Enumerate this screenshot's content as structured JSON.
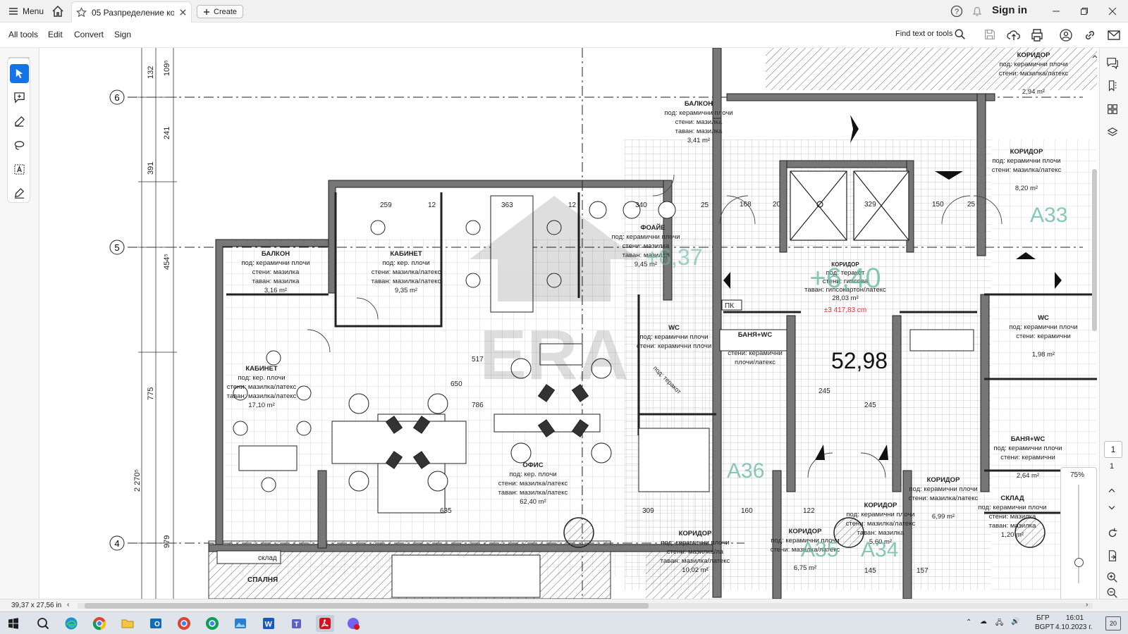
{
  "titlebar": {
    "menu_label": "Menu",
    "tab_title": "05 Разпределение кот...",
    "create_label": "Create",
    "signin_label": "Sign in"
  },
  "toolbar": {
    "items": [
      "All tools",
      "Edit",
      "Convert",
      "Sign"
    ],
    "find_label": "Find text or tools"
  },
  "left_tools": [
    "select-tool",
    "add-comment-tool",
    "highlight-tool",
    "draw-lasso-tool",
    "text-select-tool",
    "fill-sign-tool"
  ],
  "plan": {
    "grid_bubbles": [
      "6",
      "5",
      "4"
    ],
    "rooms": [
      {
        "title": "БАЛКОН",
        "lines": [
          "под: керамични плочи",
          "стени: мазилка",
          "таван: мазилка",
          "3,41 m²"
        ]
      },
      {
        "title": "БАЛКОН",
        "lines": [
          "под: керамични плочи",
          "стени: мазилка",
          "таван: мазилка",
          "3,16 m²"
        ]
      },
      {
        "title": "КАБИНЕТ",
        "lines": [
          "под: кер. плочи",
          "стени: мазилка/латекс",
          "таван: мазилка/латекс",
          "9,35 m²"
        ]
      },
      {
        "title": "ФОАЙЕ",
        "lines": [
          "под: керамични плочи",
          "стени: мазилка",
          "таван: мазилка",
          "9,45 m²"
        ]
      },
      {
        "title": "КАБИНЕТ",
        "lines": [
          "под: кер. плочи",
          "стени: мазилка/латекс",
          "таван: мазилка/латекс",
          "17,10 m²"
        ]
      },
      {
        "title": "ОФИС",
        "lines": [
          "под: кер. плочи",
          "стени: мазилка/латекс",
          "таван: мазилка/латекс",
          "62,40 m²"
        ]
      },
      {
        "title": "WC",
        "lines": [
          "под: керамични плочи",
          "стени: керамични плочи"
        ]
      },
      {
        "title": "БАНЯ+WC",
        "lines": [
          "стени: керамични",
          "плочи/латекс"
        ]
      },
      {
        "title": "КОРИДОР",
        "lines": [
          "под: теракот",
          "стени: гипсова",
          "таван: гипсокартон/латекс",
          "28,03 m²"
        ]
      },
      {
        "title": "КОРИДОР",
        "lines": [
          "под: керамични плочи",
          "стени: мазилка/латекс",
          "2,94 m²"
        ]
      },
      {
        "title": "КОРИДОР",
        "lines": [
          "под: керамични плочи",
          "стени: мазилка/латекс",
          "8,20 m²"
        ]
      },
      {
        "title": "WC",
        "lines": [
          "под: керамични плочи",
          "стени: керамични",
          "1,98 m²"
        ]
      },
      {
        "title": "БАНЯ+WC",
        "lines": [
          "под: керамични плочи",
          "стени: керамични",
          "2,64 m²"
        ]
      },
      {
        "title": "СКЛАД",
        "lines": [
          "под: керамични плочи",
          "стени: мазилка",
          "таван: мазилка",
          "1,20 m²"
        ]
      },
      {
        "title": "КОРИДОР",
        "lines": [
          "под: керамични плочи",
          "стени: мазилка/латекс",
          "6,99 m²"
        ]
      },
      {
        "title": "КОРИДОР",
        "lines": [
          "под: керамични плочи",
          "стени: мазилка/латекс",
          "таван: мазилка",
          "5,60 m²"
        ]
      },
      {
        "title": "КОРИДОР",
        "lines": [
          "под: керамични плочи",
          "стени: мазилка/латекс",
          "6,75 m²"
        ]
      },
      {
        "title": "КОРИДОР",
        "lines": [
          "под: керамични плочи",
          "стени: мазилка/ла",
          "таван: мазилка/латекс",
          "10,02 m²"
        ]
      }
    ],
    "big_area": "52,98",
    "level_mark": "+6,40",
    "level_mark2": "+6,37",
    "level_red": "±3 417,83 cm",
    "unit_labels": [
      "A33",
      "A34",
      "A35",
      "A36"
    ],
    "dims_v": [
      "132",
      "109⁵",
      "241",
      "391",
      "454⁵",
      "775",
      "2 270⁵",
      "979"
    ],
    "dims_h": [
      "259",
      "12",
      "363",
      "12",
      "340",
      "25",
      "650",
      "786",
      "517",
      "635",
      "309",
      "160",
      "245",
      "245",
      "122",
      "145",
      "157",
      "329",
      "168",
      "20",
      "150",
      "25"
    ],
    "small_labels": [
      "склад",
      "СПАЛНЯ",
      "ПК",
      "под: теракот"
    ],
    "watermark": "ERA"
  },
  "nav": {
    "page": "1",
    "total": "1",
    "zoom": "75%"
  },
  "status": {
    "size": "39,37 x 27,56 in"
  },
  "taskbar": {
    "lang": "БГР",
    "lang2": "BGPT",
    "time": "16:01",
    "date": "4.10.2023 г.",
    "notif": "20"
  }
}
